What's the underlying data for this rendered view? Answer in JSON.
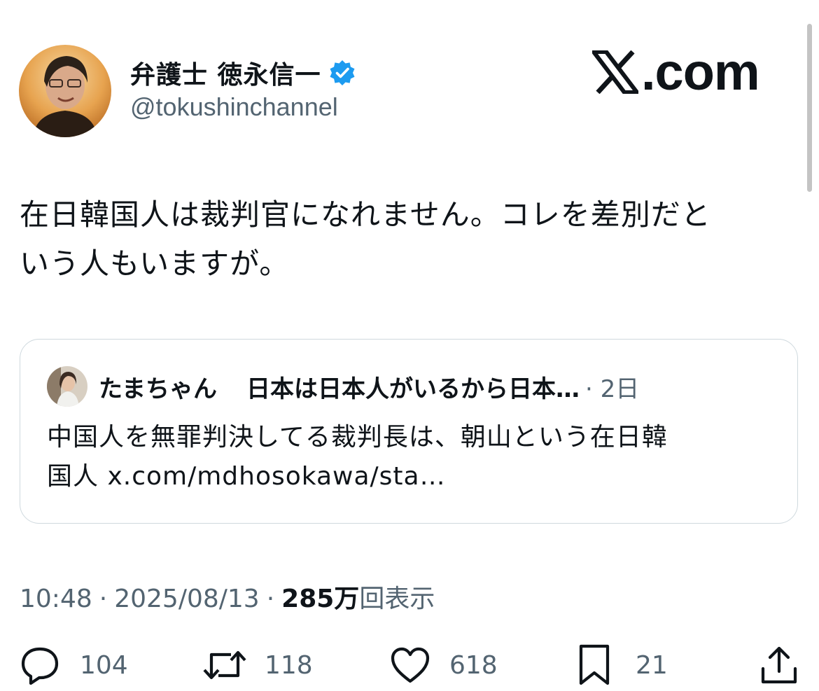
{
  "author": {
    "name": "弁護士 徳永信一",
    "handle": "@tokushinchannel",
    "verified_color": "#1d9bf0"
  },
  "site_logo": ".com",
  "tweet": {
    "text_line1": "在日韓国人は裁判官になれません。コレを差別だと",
    "text_line2": "いう人もいますが。"
  },
  "quote": {
    "name": "たまちゃん",
    "bio": "日本は日本人がいるから日本…",
    "meta": "· 2日",
    "text_line1": "中国人を無罪判決してる裁判長は、朝山という在日韓",
    "text_line2": "国人 x.com/mdhosokawa/sta…"
  },
  "meta": {
    "time": "10:48",
    "sep1": "·",
    "date": "2025/08/13",
    "sep2": "·",
    "views": "285万",
    "views_label": "回表示"
  },
  "actions": {
    "replies": "104",
    "reposts": "118",
    "likes": "618",
    "bookmarks": "21"
  },
  "icons": {
    "reply": "reply-icon",
    "repost": "repost-icon",
    "like": "heart-icon",
    "bookmark": "bookmark-icon",
    "share": "share-icon"
  }
}
